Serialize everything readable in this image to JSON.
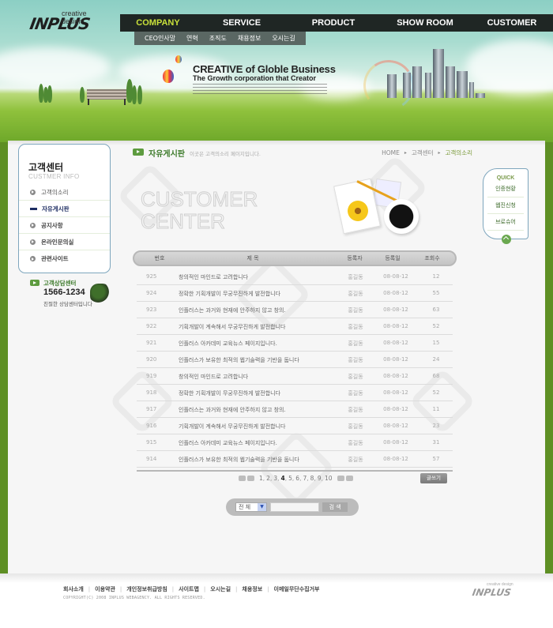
{
  "brand": {
    "name": "INPLUS",
    "tagline": "creative design"
  },
  "nav": {
    "items": [
      {
        "label": "COMPANY",
        "active": true
      },
      {
        "label": "SERVICE",
        "active": false
      },
      {
        "label": "PRODUCT",
        "active": false
      },
      {
        "label": "SHOW ROOM",
        "active": false
      },
      {
        "label": "CUSTOMER",
        "active": false
      }
    ],
    "subnav": [
      "CEO인사말",
      "연혁",
      "조직도",
      "채용정보",
      "오시는길"
    ]
  },
  "banner": {
    "headline": "CREATIVE of Globle Business",
    "subheadline": "The Growth corporation that Creator"
  },
  "sidebar": {
    "title": "고객센터",
    "subtitle": "CUSTMER INFO",
    "items": [
      {
        "label": "고객의소리",
        "state": "normal"
      },
      {
        "label": "자유게시판",
        "state": "active"
      },
      {
        "label": "공지사항",
        "state": "bold"
      },
      {
        "label": "온라인문의실",
        "state": "bold"
      },
      {
        "label": "관련사이트",
        "state": "bold"
      }
    ],
    "contact": {
      "title": "고객상담센터",
      "phone": "1566-1234",
      "description": "친절한 상담센터입니다"
    }
  },
  "board": {
    "title": "자유게시판",
    "description": "이곳은 고객의소리 페이지입니다.",
    "breadcrumb": [
      "HOME",
      "고객센터",
      "고객의소리"
    ],
    "hero_title": [
      "CUSTOMER",
      "CENTER"
    ],
    "columns": [
      "번호",
      "제 목",
      "등록자",
      "등록일",
      "조회수"
    ],
    "rows": [
      {
        "no": "925",
        "subject": "창의적인 마인드로 고려합니다",
        "author": "홍길동",
        "date": "08-08-12",
        "hits": "12"
      },
      {
        "no": "924",
        "subject": "정확한 기획개발이 무궁무진하게 발전합니다",
        "author": "홍길동",
        "date": "08-08-12",
        "hits": "55"
      },
      {
        "no": "923",
        "subject": "인플러스는 과거와 현재에 안주하지 않고 창의.",
        "author": "홍길동",
        "date": "08-08-12",
        "hits": "63"
      },
      {
        "no": "922",
        "subject": "기획개발이 계속해서 무궁무진하게 발전합니다",
        "author": "홍길동",
        "date": "08-08-12",
        "hits": "52"
      },
      {
        "no": "921",
        "subject": "인플러스 아카데미 교육뉴스 페이지입니다.",
        "author": "홍길동",
        "date": "08-08-12",
        "hits": "15"
      },
      {
        "no": "920",
        "subject": "인플러스가 보유한 최적의 웹기술력을 기반을 둡니다",
        "author": "홍길동",
        "date": "08-08-12",
        "hits": "24"
      },
      {
        "no": "919",
        "subject": "창의적인 마인드로 고려합니다",
        "author": "홍길동",
        "date": "08-08-12",
        "hits": "68"
      },
      {
        "no": "918",
        "subject": "정확한 기획개발이 무궁무진하게 발전합니다",
        "author": "홍길동",
        "date": "08-08-12",
        "hits": "52"
      },
      {
        "no": "917",
        "subject": "인플러스는 과거와 현재에 안주하지 않고 창의.",
        "author": "홍길동",
        "date": "08-08-12",
        "hits": "11"
      },
      {
        "no": "916",
        "subject": "기획개발이 계속해서 무궁무진하게 발전합니다",
        "author": "홍길동",
        "date": "08-08-12",
        "hits": "23"
      },
      {
        "no": "915",
        "subject": "인플러스 아카데미 교육뉴스 페이지입니다.",
        "author": "홍길동",
        "date": "08-08-12",
        "hits": "31"
      },
      {
        "no": "914",
        "subject": "인플러스가 보유한 최적의 웹기술력을 기반을 둡니다",
        "author": "홍길동",
        "date": "08-08-12",
        "hits": "57"
      }
    ],
    "pagination": {
      "pages": [
        "1",
        "2",
        "3",
        "4",
        "5",
        "6",
        "7",
        "8",
        "9",
        "10"
      ],
      "current": "4"
    },
    "write_label": "글쓰기",
    "search": {
      "scope": "전 체",
      "query": "",
      "button_label": "검 색"
    }
  },
  "quick_menu": {
    "title": "QUICK",
    "items": [
      "인증현황",
      "웹진신청",
      "브로슈어"
    ]
  },
  "footer": {
    "links": [
      "회사소개",
      "이용약관",
      "개인정보취급방침",
      "사이트맵",
      "오시는길",
      "채용정보",
      "이메일무단수집거부"
    ],
    "copyright": "COPYRIGHT(C) 2008 INPLUS WEBAGENCY. ALL RIGHTS RESERVED."
  },
  "colors": {
    "nav_bg": "#1f2624",
    "nav_active": "#c8e03a",
    "accent_green": "#3c7a2a",
    "sidebar_border": "#7ea6bd",
    "active_item": "#1d2d62"
  }
}
